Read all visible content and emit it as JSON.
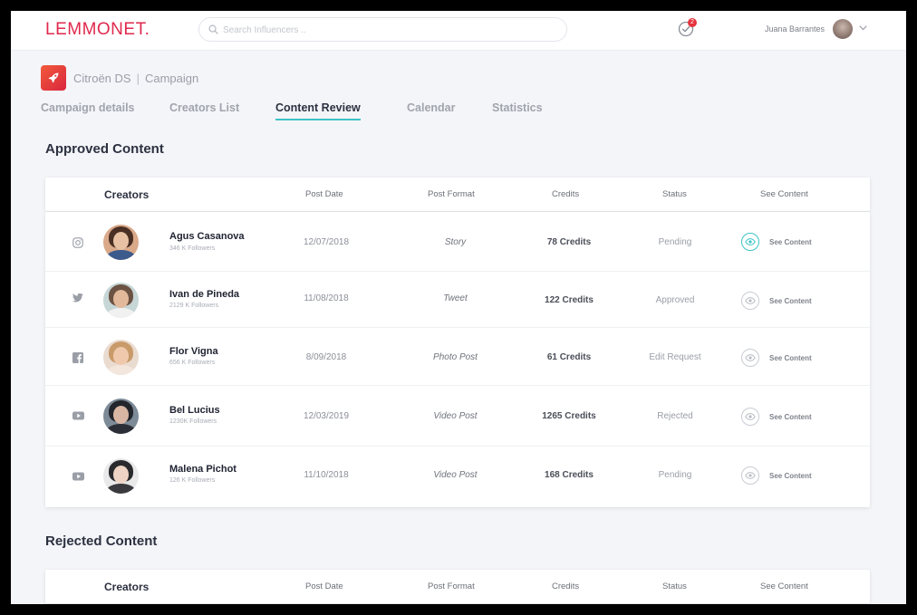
{
  "app": {
    "logo": "LEMMONET.",
    "search_placeholder": "Search Influencers ..",
    "notifications_count": "2",
    "user_name": "Juana Barrantes"
  },
  "campaign": {
    "brand": "Citroën DS",
    "separator": "|",
    "name": "Campaign"
  },
  "tabs": [
    {
      "label": "Campaign details",
      "active": false
    },
    {
      "label": "Creators List",
      "active": false
    },
    {
      "label": "Content  Review",
      "active": true
    },
    {
      "label": "Calendar",
      "active": false
    },
    {
      "label": "Statistics",
      "active": false
    }
  ],
  "approved": {
    "title": "Approved Content",
    "columns": {
      "creators": "Creators",
      "post_date": "Post Date",
      "post_format": "Post Format",
      "credits": "Credits",
      "status": "Status",
      "see_content": "See Content"
    },
    "rows": [
      {
        "social": "instagram-icon",
        "name": "Agus Casanova",
        "followers": "346 K Followers",
        "date": "12/07/2018",
        "format": "Story",
        "credits": "78 Credits",
        "status": "Pending",
        "see": "See Content",
        "eye_active": true
      },
      {
        "social": "twitter-icon",
        "name": "Ivan de Pineda",
        "followers": "2129 K Followers",
        "date": "11/08/2018",
        "format": "Tweet",
        "credits": "122 Credits",
        "status": "Approved",
        "see": "See Content",
        "eye_active": false
      },
      {
        "social": "facebook-icon",
        "name": "Flor Vigna",
        "followers": "656 K Followers",
        "date": "8/09/2018",
        "format": "Photo Post",
        "credits": "61 Credits",
        "status": "Edit Request",
        "see": "See Content",
        "eye_active": false
      },
      {
        "social": "youtube-icon",
        "name": "Bel Lucius",
        "followers": "1230K Followers",
        "date": "12/03/2019",
        "format": "Video Post",
        "credits": "1265 Credits",
        "status": "Rejected",
        "see": "See Content",
        "eye_active": false
      },
      {
        "social": "youtube-icon",
        "name": "Malena Pichot",
        "followers": "126 K Followers",
        "date": "11/10/2018",
        "format": "Video Post",
        "credits": "168 Credits",
        "status": "Pending",
        "see": "See Content",
        "eye_active": false
      }
    ]
  },
  "rejected": {
    "title": "Rejected Content",
    "columns": {
      "creators": "Creators",
      "post_date": "Post Date",
      "post_format": "Post Format",
      "credits": "Credits",
      "status": "Status",
      "see_content": "See Content"
    }
  },
  "colors": {
    "brand": "#e0294d",
    "accent": "#3cc3c6",
    "text_dark": "#2c3140",
    "text_muted": "#a0a4ad",
    "background": "#f4f5f9"
  }
}
